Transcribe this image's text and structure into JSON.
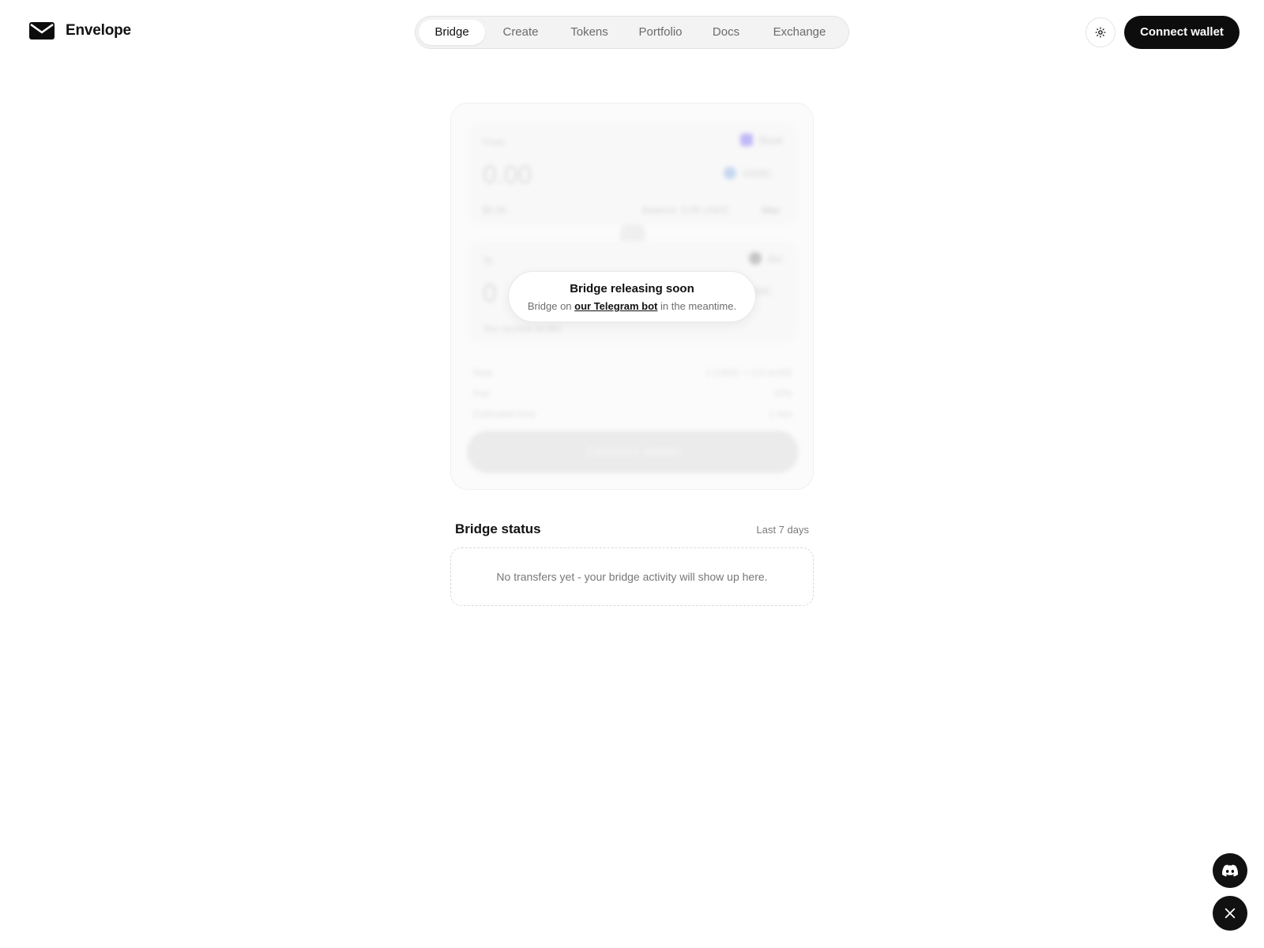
{
  "brand": {
    "name": "Envelope",
    "logo_icon": "envelope-icon"
  },
  "nav": {
    "items": [
      {
        "label": "Bridge",
        "active": true
      },
      {
        "label": "Create",
        "active": false
      },
      {
        "label": "Tokens",
        "active": false
      },
      {
        "label": "Portfolio",
        "active": false
      },
      {
        "label": "Docs",
        "active": false
      },
      {
        "label": "Exchange",
        "active": false
      }
    ]
  },
  "header": {
    "settings_icon": "gear-icon",
    "connect_label": "Connect wallet"
  },
  "bridge_form": {
    "from_label": "From",
    "from_chain": "Base",
    "from_amount": "0.00",
    "from_token": "USDC",
    "from_usd": "$0.00",
    "balance_text": "Balance: 0.00 USDC",
    "max_label": "Max",
    "to_label": "To",
    "to_chain": "Arc",
    "to_amount": "0",
    "to_token": "USDC",
    "receive_text": "You receive on Arc",
    "rate_label": "Rate",
    "rate_value": "1 USDC = 0.9 eUSD",
    "fee_label": "Fee",
    "fee_value": "10%",
    "time_label": "Estimated time",
    "time_value": "1 min",
    "button_label": "Connect wallet"
  },
  "notice": {
    "title": "Bridge releasing soon",
    "prefix": "Bridge on",
    "link": "our Telegram bot",
    "suffix": "in the meantime."
  },
  "status": {
    "title": "Bridge status",
    "range": "Last 7 days",
    "empty": "No transfers yet - your bridge activity will show up here."
  },
  "social": {
    "discord_icon": "discord-icon",
    "x_icon": "x-icon"
  },
  "colors": {
    "primary": "#0d0d0d",
    "background": "#ffffff",
    "nav_bg": "#f3f3f3",
    "base_chain": "#7b6cf0",
    "usdc": "#6d9fe0"
  }
}
